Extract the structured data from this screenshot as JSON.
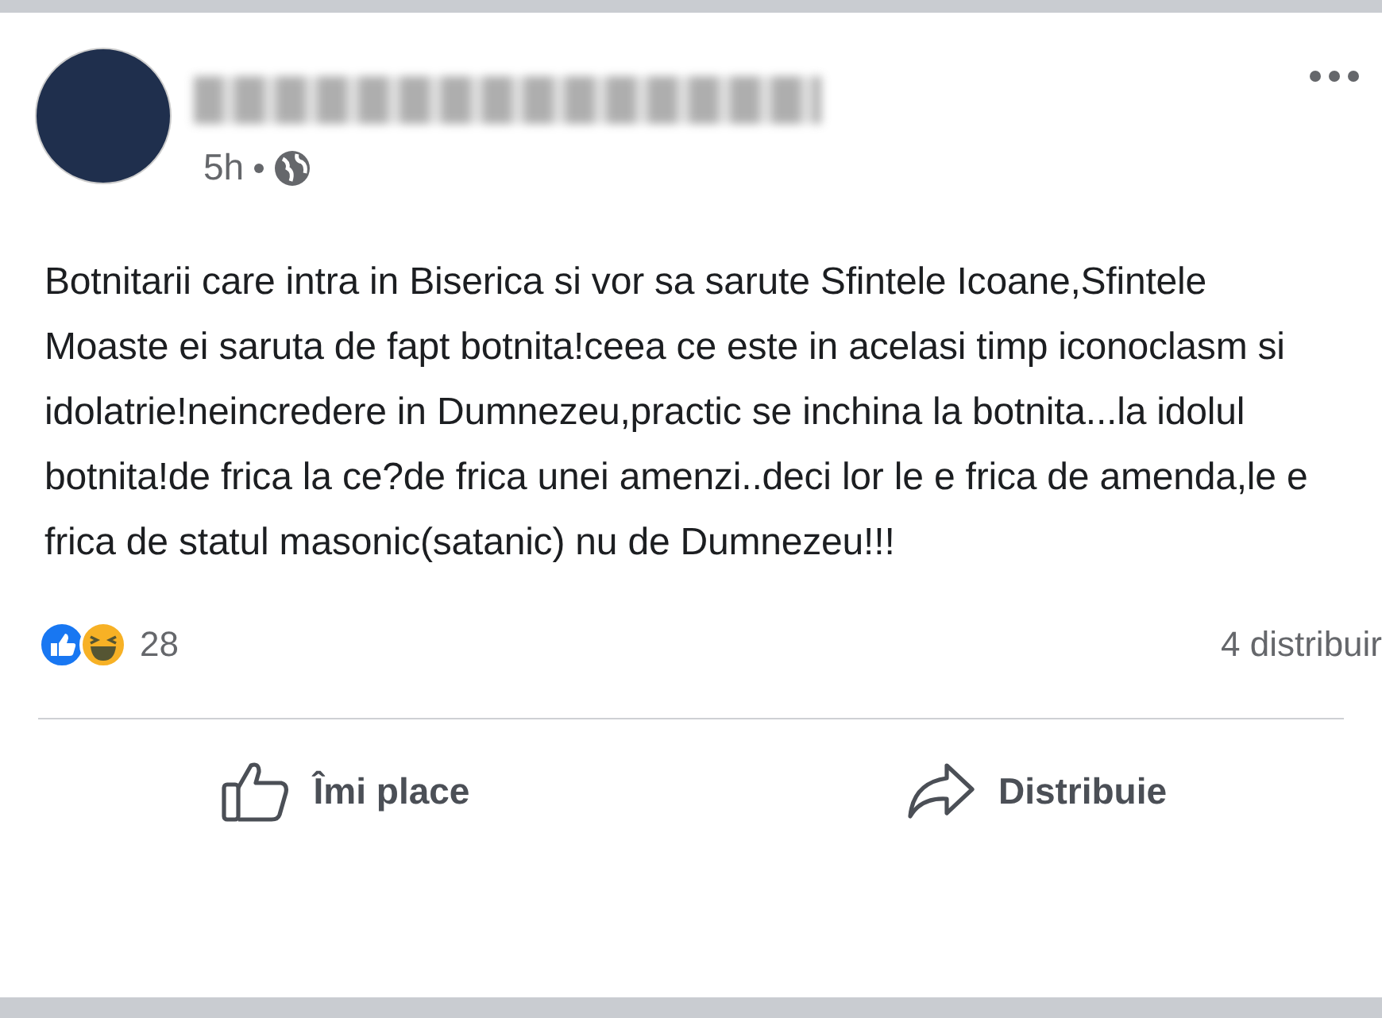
{
  "post": {
    "time": "5h",
    "text": "Botnitarii care intra in Biserica si vor sa sarute Sfintele Icoane,Sfintele Moaste  ei saruta de fapt botnita!ceea ce este in acelasi timp iconoclasm si idolatrie!neincredere in Dumnezeu,practic se inchina la botnita...la idolul botnita!de frica la ce?de frica unei amenzi..deci lor le e frica de amenda,le e frica de statul masonic(satanic) nu de Dumnezeu!!!",
    "reactions_count": "28",
    "shares": "4 distribuir",
    "actions": [
      {
        "kind": "like",
        "label": "Îmi place"
      },
      {
        "kind": "share",
        "label": "Distribuie"
      }
    ]
  }
}
